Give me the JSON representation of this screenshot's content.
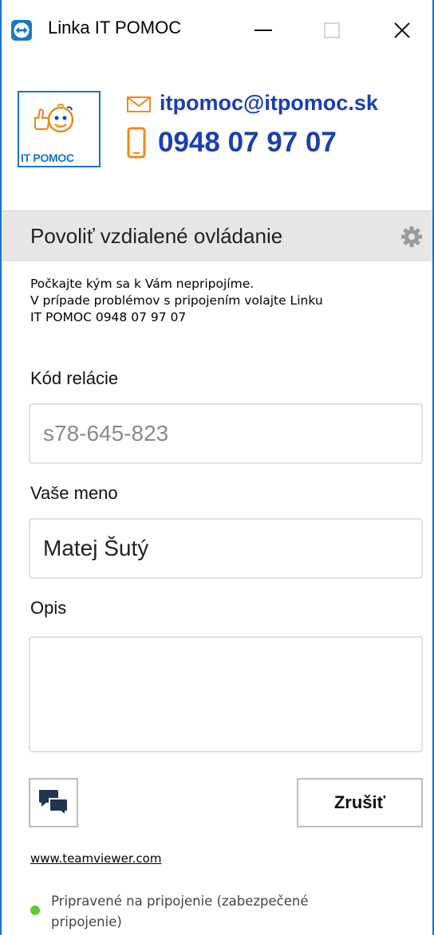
{
  "window": {
    "title": "Linka IT POMOC",
    "app_icon": "teamviewer-arrows-icon",
    "controls": [
      "minimize-icon",
      "maximize-icon",
      "close-icon"
    ]
  },
  "brand": {
    "logo_text": "IT POMOC",
    "email": "itpomoc@itpomoc.sk",
    "phone": "0948 07 97 07",
    "accent_color": "#f08a1c",
    "text_color": "#1a3fae"
  },
  "section": {
    "title": "Povoliť vzdialené ovládanie",
    "settings_icon": "gear-icon"
  },
  "info": {
    "line1": "Počkajte kým sa k Vám nepripojíme.",
    "line2": "V prípade problémov s pripojením volajte Linku",
    "line3": "IT POMOC 0948 07 97 07"
  },
  "form": {
    "session_label": "Kód relácie",
    "session_placeholder": "s78-645-823",
    "name_label": "Vaše meno",
    "name_value": "Matej Šutý",
    "desc_label": "Opis",
    "desc_value": ""
  },
  "actions": {
    "chat_icon": "chat-bubbles-icon",
    "cancel_label": "Zrušiť"
  },
  "footer": {
    "link": "www.teamviewer.com",
    "status_line1": "Pripravené na pripojenie (zabezpečené",
    "status_line2": "pripojenie)",
    "status_color": "#5fc92e"
  }
}
